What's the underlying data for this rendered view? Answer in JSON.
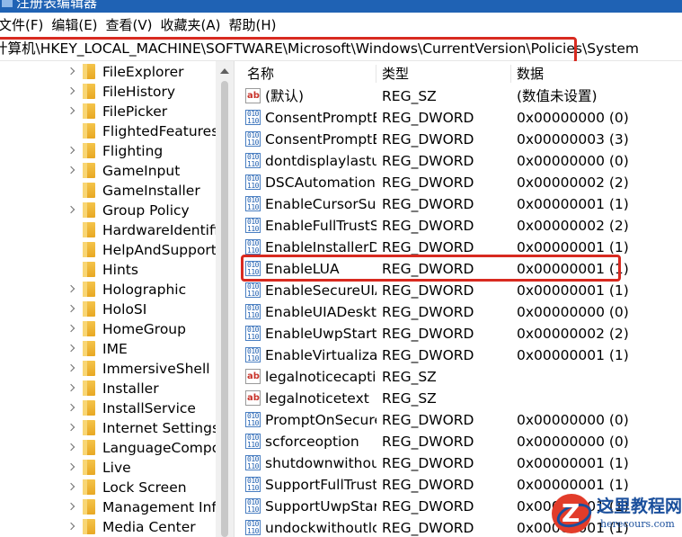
{
  "window": {
    "title": "注册表编辑器"
  },
  "menu": [
    "文件(F)",
    "编辑(E)",
    "查看(V)",
    "收藏夹(A)",
    "帮助(H)"
  ],
  "address": "计算机\\HKEY_LOCAL_MACHINE\\SOFTWARE\\Microsoft\\Windows\\CurrentVersion\\Policies\\System",
  "tree": [
    {
      "label": "FileExplorer",
      "expandable": true
    },
    {
      "label": "FileHistory",
      "expandable": true
    },
    {
      "label": "FilePicker",
      "expandable": true
    },
    {
      "label": "FlightedFeatures",
      "expandable": false
    },
    {
      "label": "Flighting",
      "expandable": true
    },
    {
      "label": "GameInput",
      "expandable": true
    },
    {
      "label": "GameInstaller",
      "expandable": false
    },
    {
      "label": "Group Policy",
      "expandable": true
    },
    {
      "label": "HardwareIdentification",
      "expandable": false
    },
    {
      "label": "HelpAndSupport",
      "expandable": false
    },
    {
      "label": "Hints",
      "expandable": false
    },
    {
      "label": "Holographic",
      "expandable": true
    },
    {
      "label": "HoloSI",
      "expandable": true
    },
    {
      "label": "HomeGroup",
      "expandable": true
    },
    {
      "label": "IME",
      "expandable": true
    },
    {
      "label": "ImmersiveShell",
      "expandable": true
    },
    {
      "label": "Installer",
      "expandable": true
    },
    {
      "label": "InstallService",
      "expandable": true
    },
    {
      "label": "Internet Settings",
      "expandable": true
    },
    {
      "label": "LanguageComponentsInstaller",
      "expandable": true
    },
    {
      "label": "Live",
      "expandable": true
    },
    {
      "label": "Lock Screen",
      "expandable": true
    },
    {
      "label": "Management Infrastructure",
      "expandable": true
    },
    {
      "label": "Media Center",
      "expandable": true
    }
  ],
  "columns": {
    "name": "名称",
    "type": "类型",
    "data": "数据"
  },
  "values": [
    {
      "icon": "string-value-icon",
      "name": "(默认)",
      "type": "REG_SZ",
      "data": "(数值未设置)"
    },
    {
      "icon": "dword-value-icon",
      "name": "ConsentPromptBehaviorAdmin",
      "type": "REG_DWORD",
      "data": "0x00000000 (0)"
    },
    {
      "icon": "dword-value-icon",
      "name": "ConsentPromptBehaviorUser",
      "type": "REG_DWORD",
      "data": "0x00000003 (3)"
    },
    {
      "icon": "dword-value-icon",
      "name": "dontdisplaylastusername",
      "type": "REG_DWORD",
      "data": "0x00000000 (0)"
    },
    {
      "icon": "dword-value-icon",
      "name": "DSCAutomationHostEnabled",
      "type": "REG_DWORD",
      "data": "0x00000002 (2)"
    },
    {
      "icon": "dword-value-icon",
      "name": "EnableCursorSuppression",
      "type": "REG_DWORD",
      "data": "0x00000001 (1)"
    },
    {
      "icon": "dword-value-icon",
      "name": "EnableFullTrustStartupTasks",
      "type": "REG_DWORD",
      "data": "0x00000002 (2)"
    },
    {
      "icon": "dword-value-icon",
      "name": "EnableInstallerDetection",
      "type": "REG_DWORD",
      "data": "0x00000001 (1)"
    },
    {
      "icon": "dword-value-icon",
      "name": "EnableLUA",
      "type": "REG_DWORD",
      "data": "0x00000001 (1)"
    },
    {
      "icon": "dword-value-icon",
      "name": "EnableSecureUIAPaths",
      "type": "REG_DWORD",
      "data": "0x00000001 (1)"
    },
    {
      "icon": "dword-value-icon",
      "name": "EnableUIADesktopToggle",
      "type": "REG_DWORD",
      "data": "0x00000000 (0)"
    },
    {
      "icon": "dword-value-icon",
      "name": "EnableUwpStartupTasks",
      "type": "REG_DWORD",
      "data": "0x00000002 (2)"
    },
    {
      "icon": "dword-value-icon",
      "name": "EnableVirtualization",
      "type": "REG_DWORD",
      "data": "0x00000001 (1)"
    },
    {
      "icon": "string-value-icon",
      "name": "legalnoticecaption",
      "type": "REG_SZ",
      "data": ""
    },
    {
      "icon": "string-value-icon",
      "name": "legalnoticetext",
      "type": "REG_SZ",
      "data": ""
    },
    {
      "icon": "dword-value-icon",
      "name": "PromptOnSecureDesktop",
      "type": "REG_DWORD",
      "data": "0x00000000 (0)"
    },
    {
      "icon": "dword-value-icon",
      "name": "scforceoption",
      "type": "REG_DWORD",
      "data": "0x00000000 (0)"
    },
    {
      "icon": "dword-value-icon",
      "name": "shutdownwithoutlogon",
      "type": "REG_DWORD",
      "data": "0x00000001 (1)"
    },
    {
      "icon": "dword-value-icon",
      "name": "SupportFullTrustStartupTasks",
      "type": "REG_DWORD",
      "data": "0x00000001 (1)"
    },
    {
      "icon": "dword-value-icon",
      "name": "SupportUwpStartupTasks",
      "type": "REG_DWORD",
      "data": "0x00000001 (1)"
    },
    {
      "icon": "dword-value-icon",
      "name": "undockwithoutlogon",
      "type": "REG_DWORD",
      "data": "0x00000001 (1)"
    }
  ],
  "annotation": {
    "color": "#d82a20"
  },
  "watermark": {
    "title": "这里教程网",
    "url": "herecours.com"
  }
}
